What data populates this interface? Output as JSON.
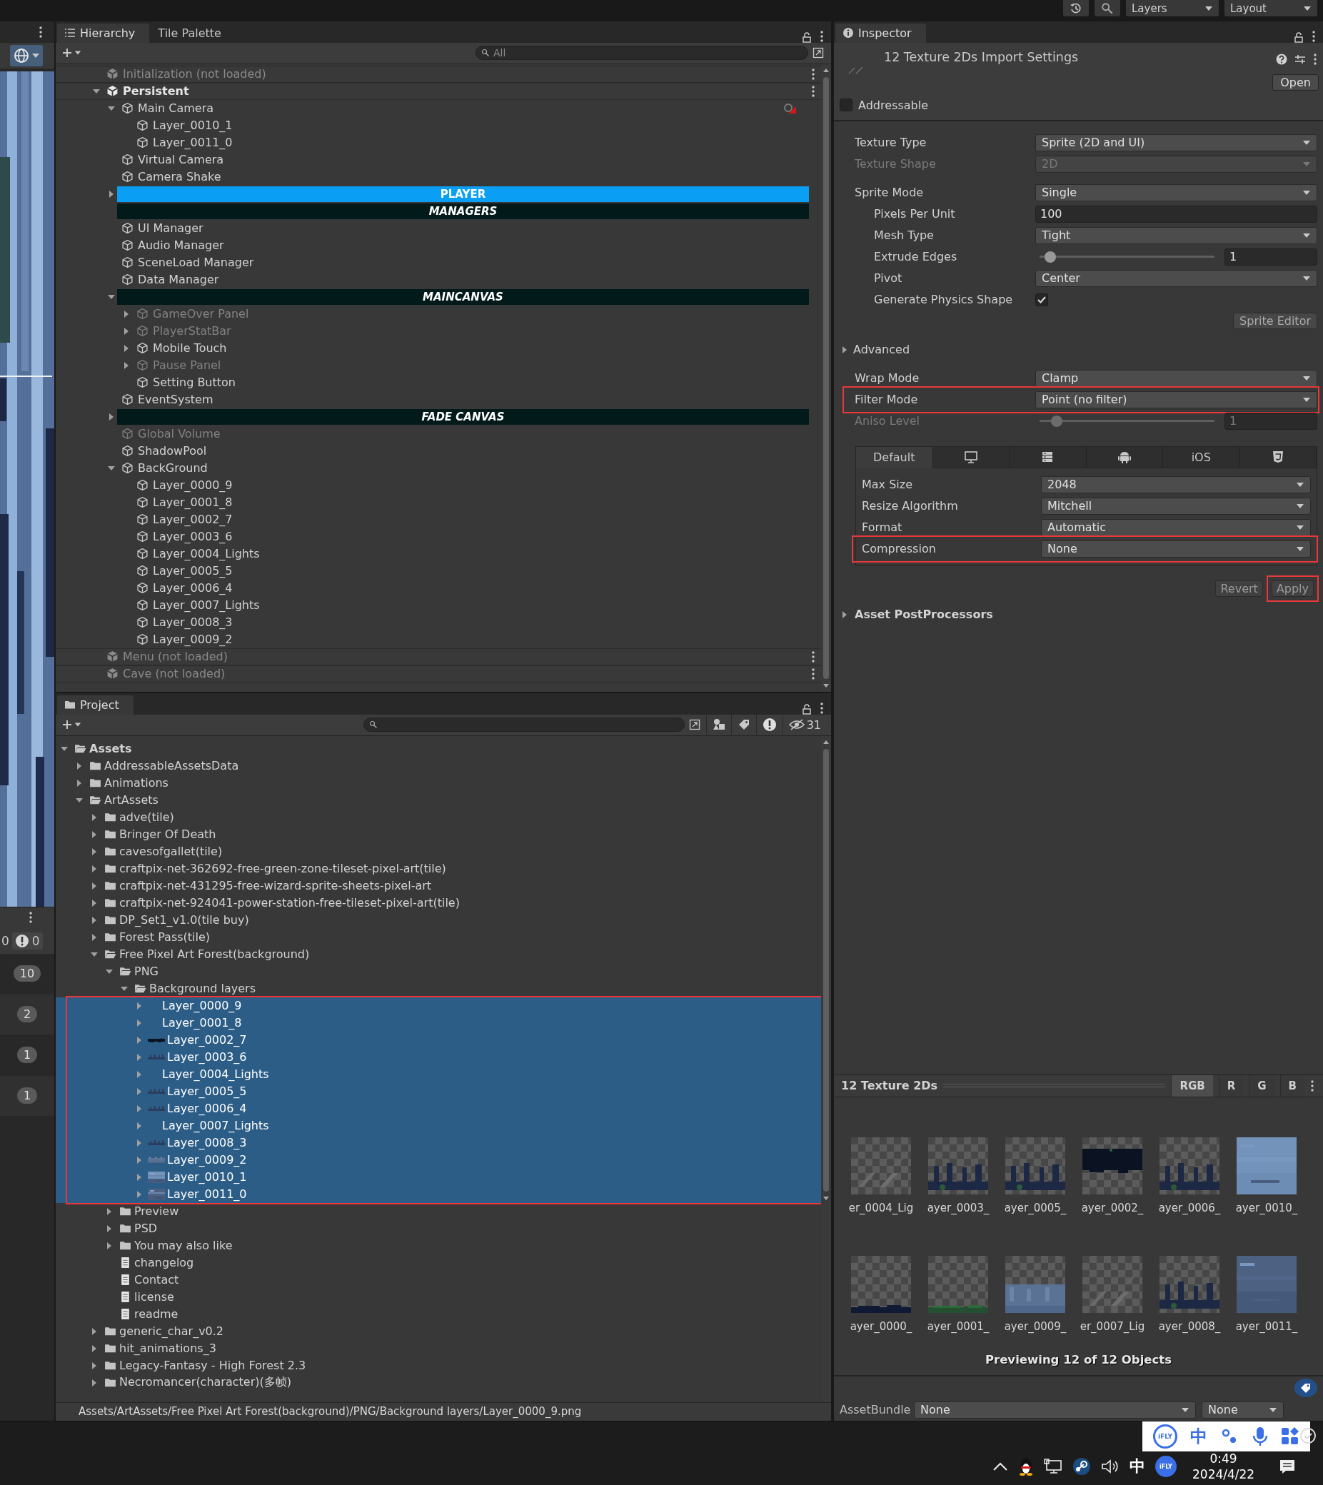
{
  "toolbar": {
    "buttons": [
      {
        "kind": "history"
      },
      {
        "kind": "search"
      }
    ],
    "dropdowns": [
      "Layers",
      "Layout"
    ]
  },
  "console_strip": {
    "counts": [
      {
        "kind": "plain",
        "text": "0"
      },
      {
        "kind": "warning",
        "text": "0"
      }
    ],
    "badges": [
      "10",
      "2",
      "1",
      "1"
    ]
  },
  "hierarchy": {
    "tabs": [
      {
        "label": "Hierarchy",
        "selected": true
      },
      {
        "label": "Tile Palette",
        "selected": false
      }
    ],
    "search": {
      "placeholder": "All"
    },
    "items": [
      {
        "kind": "scene",
        "label": "Initialization (not loaded)",
        "loaded": false
      },
      {
        "kind": "scene",
        "label": "Persistent",
        "loaded": true,
        "expanded": true,
        "children": [
          {
            "kind": "object",
            "label": "Main Camera",
            "disabled": false,
            "expanded": true,
            "gizmo": true,
            "children": [
              {
                "kind": "object",
                "label": "Layer_0010_1",
                "disabled": false
              },
              {
                "kind": "object",
                "label": "Layer_0011_0",
                "disabled": false
              }
            ]
          },
          {
            "kind": "object",
            "label": "Virtual Camera",
            "disabled": false
          },
          {
            "kind": "object",
            "label": "Camera Shake",
            "disabled": false
          },
          {
            "kind": "header",
            "label": "PLAYER",
            "color": "#0a9ff5",
            "italic": false,
            "expanded": false
          },
          {
            "kind": "header",
            "label": "MANAGERS",
            "color": "#031a1a",
            "italic": true
          },
          {
            "kind": "object",
            "label": "UI Manager",
            "disabled": false
          },
          {
            "kind": "object",
            "label": "Audio Manager",
            "disabled": false
          },
          {
            "kind": "object",
            "label": "SceneLoad Manager",
            "disabled": false
          },
          {
            "kind": "object",
            "label": "Data Manager",
            "disabled": false
          },
          {
            "kind": "header",
            "label": "MAINCANVAS",
            "color": "#031a1a",
            "italic": true,
            "expanded": true,
            "children": [
              {
                "kind": "object",
                "label": "GameOver Panel",
                "disabled": true,
                "expanded": false
              },
              {
                "kind": "object",
                "label": "PlayerStatBar",
                "disabled": true,
                "expanded": false
              },
              {
                "kind": "object",
                "label": "Mobile Touch",
                "disabled": false,
                "expanded": false
              },
              {
                "kind": "object",
                "label": "Pause Panel",
                "disabled": true,
                "expanded": false
              },
              {
                "kind": "object",
                "label": "Setting Button",
                "disabled": false
              }
            ]
          },
          {
            "kind": "object",
            "label": "EventSystem",
            "disabled": false
          },
          {
            "kind": "header",
            "label": "FADE CANVAS",
            "color": "#031a1a",
            "italic": true,
            "expanded": false
          },
          {
            "kind": "object",
            "label": "Global Volume",
            "disabled": true
          },
          {
            "kind": "object",
            "label": "ShadowPool",
            "disabled": false
          },
          {
            "kind": "object",
            "label": "BackGround",
            "disabled": false,
            "expanded": true,
            "children": [
              {
                "kind": "object",
                "label": "Layer_0000_9",
                "disabled": false
              },
              {
                "kind": "object",
                "label": "Layer_0001_8",
                "disabled": false
              },
              {
                "kind": "object",
                "label": "Layer_0002_7",
                "disabled": false
              },
              {
                "kind": "object",
                "label": "Layer_0003_6",
                "disabled": false
              },
              {
                "kind": "object",
                "label": "Layer_0004_Lights",
                "disabled": false
              },
              {
                "kind": "object",
                "label": "Layer_0005_5",
                "disabled": false
              },
              {
                "kind": "object",
                "label": "Layer_0006_4",
                "disabled": false
              },
              {
                "kind": "object",
                "label": "Layer_0007_Lights",
                "disabled": false
              },
              {
                "kind": "object",
                "label": "Layer_0008_3",
                "disabled": false
              },
              {
                "kind": "object",
                "label": "Layer_0009_2",
                "disabled": false
              }
            ]
          }
        ]
      },
      {
        "kind": "scene",
        "label": "Menu (not loaded)",
        "loaded": false
      },
      {
        "kind": "scene",
        "label": "Cave (not loaded)",
        "loaded": false
      }
    ]
  },
  "project": {
    "tab": {
      "label": "Project",
      "selected": true
    },
    "hidden_count": "31",
    "items": [
      {
        "kind": "folder",
        "label": "Assets",
        "selected": false,
        "expanded": true,
        "children": [
          {
            "kind": "folder",
            "label": "AddressableAssetsData",
            "selected": false,
            "expanded": false
          },
          {
            "kind": "folder",
            "label": "Animations",
            "selected": false,
            "expanded": false
          },
          {
            "kind": "folder",
            "label": "ArtAssets",
            "selected": false,
            "expanded": true,
            "children": [
              {
                "kind": "folder",
                "label": "adve(tile)",
                "selected": false,
                "expanded": false
              },
              {
                "kind": "folder",
                "label": "Bringer Of Death",
                "selected": false,
                "expanded": false
              },
              {
                "kind": "folder",
                "label": "cavesofgallet(tile)",
                "selected": false,
                "expanded": false
              },
              {
                "kind": "folder",
                "label": "craftpix-net-362692-free-green-zone-tileset-pixel-art(tile)",
                "selected": false,
                "expanded": false
              },
              {
                "kind": "folder",
                "label": "craftpix-net-431295-free-wizard-sprite-sheets-pixel-art",
                "selected": false,
                "expanded": false
              },
              {
                "kind": "folder",
                "label": "craftpix-net-924041-power-station-free-tileset-pixel-art(tile)",
                "selected": false,
                "expanded": false
              },
              {
                "kind": "folder",
                "label": "DP_Set1_v1.0(tile  buy)",
                "selected": false,
                "expanded": false
              },
              {
                "kind": "folder",
                "label": "Forest Pass(tile)",
                "selected": false,
                "expanded": false
              },
              {
                "kind": "folder",
                "label": "Free Pixel Art Forest(background)",
                "selected": false,
                "expanded": true,
                "children": [
                  {
                    "kind": "folder",
                    "label": "PNG",
                    "selected": false,
                    "expanded": true,
                    "children": [
                      {
                        "kind": "folder",
                        "label": "Background layers",
                        "selected": false,
                        "expanded": true,
                        "framed": true,
                        "children": [
                          {
                            "label": "Layer_0000_9",
                            "selected": true,
                            "expanded": false
                          },
                          {
                            "label": "Layer_0001_8",
                            "selected": true,
                            "expanded": false
                          },
                          {
                            "label": "Layer_0002_7",
                            "selected": true,
                            "expanded": false
                          },
                          {
                            "label": "Layer_0003_6",
                            "selected": true,
                            "expanded": false
                          },
                          {
                            "label": "Layer_0004_Lights",
                            "selected": true,
                            "expanded": false
                          },
                          {
                            "label": "Layer_0005_5",
                            "selected": true,
                            "expanded": false
                          },
                          {
                            "label": "Layer_0006_4",
                            "selected": true,
                            "expanded": false
                          },
                          {
                            "label": "Layer_0007_Lights",
                            "selected": true,
                            "expanded": false
                          },
                          {
                            "label": "Layer_0008_3",
                            "selected": true,
                            "expanded": false
                          },
                          {
                            "label": "Layer_0009_2",
                            "selected": true,
                            "expanded": false
                          },
                          {
                            "label": "Layer_0010_1",
                            "selected": true,
                            "expanded": false
                          },
                          {
                            "label": "Layer_0011_0",
                            "selected": true,
                            "expanded": false
                          }
                        ]
                      }
                    ]
                  },
                  {
                    "kind": "folder",
                    "label": "Preview",
                    "selected": false,
                    "expanded": false
                  },
                  {
                    "kind": "folder",
                    "label": "PSD",
                    "selected": false,
                    "expanded": false
                  },
                  {
                    "kind": "folder",
                    "label": "You may also like",
                    "selected": false,
                    "expanded": false
                  },
                  {
                    "kind": "file",
                    "label": "changelog",
                    "selected": false
                  },
                  {
                    "kind": "file",
                    "label": "Contact",
                    "selected": false
                  },
                  {
                    "kind": "file",
                    "label": "license",
                    "selected": false
                  },
                  {
                    "kind": "file",
                    "label": "readme",
                    "selected": false
                  }
                ]
              },
              {
                "kind": "folder",
                "label": "generic_char_v0.2",
                "selected": false,
                "expanded": false
              },
              {
                "kind": "folder",
                "label": "hit_animations_3",
                "selected": false,
                "expanded": false
              },
              {
                "kind": "folder",
                "label": "Legacy-Fantasy - High Forest 2.3",
                "selected": false,
                "expanded": false
              },
              {
                "kind": "folder",
                "label": "Necromancer(character)(多帧)",
                "selected": false,
                "expanded": false
              }
            ]
          }
        ]
      }
    ],
    "path": "Assets/ArtAssets/Free Pixel Art Forest(background)/PNG/Background layers/Layer_0000_9.png"
  },
  "inspector": {
    "tab": {
      "label": "Inspector",
      "selected": true
    },
    "title": "12 Texture 2Ds Import Settings",
    "open_button": "Open",
    "addressable": {
      "label": "Addressable",
      "checked": false
    },
    "groups": [
      [
        {
          "kind": "dropdown",
          "label": "Texture Type",
          "value": "Sprite (2D and UI)",
          "disabled": false,
          "framed": false
        },
        {
          "kind": "dropdown",
          "label": "Texture Shape",
          "value": "2D",
          "disabled": true,
          "framed": false
        }
      ],
      [
        {
          "kind": "dropdown",
          "label": "Sprite Mode",
          "value": "Single",
          "disabled": false,
          "framed": false,
          "children": [
            {
              "kind": "number",
              "label": "Pixels Per Unit",
              "value": "100",
              "disabled": false,
              "framed": false
            },
            {
              "kind": "dropdown",
              "label": "Mesh Type",
              "value": "Tight",
              "disabled": false,
              "framed": false
            },
            {
              "kind": "slider",
              "label": "Extrude Edges",
              "level": 0.03,
              "value": "1",
              "disabled": false,
              "framed": false
            },
            {
              "kind": "dropdown",
              "label": "Pivot",
              "value": "Center",
              "disabled": false,
              "framed": false
            },
            {
              "kind": "checkbox",
              "label": "Generate Physics Shape",
              "checked": true,
              "disabled": false,
              "framed": false
            }
          ]
        },
        {
          "kind": "button",
          "label": "Sprite Editor",
          "disabled": false,
          "framed": false
        }
      ],
      [
        {
          "kind": "foldout",
          "label": "Advanced",
          "expanded": false
        }
      ],
      [
        {
          "kind": "dropdown",
          "label": "Wrap Mode",
          "value": "Clamp",
          "disabled": false,
          "framed": false
        },
        {
          "kind": "dropdown",
          "label": "Filter Mode",
          "value": "Point (no filter)",
          "disabled": false,
          "framed": true
        },
        {
          "kind": "slider",
          "label": "Aniso Level",
          "level": 0.07,
          "value": "1",
          "disabled": true,
          "framed": false
        }
      ]
    ],
    "platforms": {
      "tabs": [
        {
          "kind": "text",
          "label": "Default",
          "selected": true
        },
        {
          "kind": "monitor",
          "selected": false
        },
        {
          "kind": "server",
          "selected": false
        },
        {
          "kind": "android",
          "selected": false
        },
        {
          "kind": "text",
          "label": "iOS",
          "selected": false
        },
        {
          "kind": "html5",
          "selected": false
        }
      ],
      "fields": [
        {
          "kind": "dropdown",
          "label": "Max Size",
          "value": "2048",
          "disabled": false,
          "framed": false
        },
        {
          "kind": "dropdown",
          "label": "Resize Algorithm",
          "value": "Mitchell",
          "disabled": false,
          "framed": false
        },
        {
          "kind": "dropdown",
          "label": "Format",
          "value": "Automatic",
          "disabled": false,
          "framed": false
        },
        {
          "kind": "dropdown",
          "label": "Compression",
          "value": "None",
          "disabled": false,
          "framed": true
        }
      ]
    },
    "actions": [
      {
        "label": "Revert",
        "framed": false
      },
      {
        "label": "Apply",
        "framed": true
      }
    ],
    "postprocessors": {
      "label": "Asset PostProcessors",
      "expanded": false
    },
    "preview": {
      "title": "12 Texture 2Ds",
      "channels": [
        {
          "label": "RGB",
          "selected": true
        },
        {
          "label": "R",
          "selected": false
        },
        {
          "label": "G",
          "selected": false
        },
        {
          "label": "B",
          "selected": false
        }
      ],
      "items": [
        {
          "label": "er_0004_Lig"
        },
        {
          "label": "ayer_0003_"
        },
        {
          "label": "ayer_0005_"
        },
        {
          "label": "ayer_0002_"
        },
        {
          "label": "ayer_0006_"
        },
        {
          "label": "ayer_0010_"
        },
        {
          "label": "ayer_0000_"
        },
        {
          "label": "ayer_0001_"
        },
        {
          "label": "ayer_0009_"
        },
        {
          "label": "er_0007_Lig"
        },
        {
          "label": "ayer_0008_"
        },
        {
          "label": "ayer_0011_"
        }
      ],
      "caption": "Previewing 12 of 12 Objects"
    },
    "asset_bundle": {
      "label": "AssetBundle",
      "values": [
        "None",
        "None"
      ]
    }
  },
  "taskbar": {
    "ime": {
      "logo": "iFLY",
      "mode": "中"
    },
    "tray": {
      "input_mode": "中",
      "logo": "iFLY"
    },
    "clock": {
      "time": "0:49",
      "date": "2024/4/22"
    }
  }
}
